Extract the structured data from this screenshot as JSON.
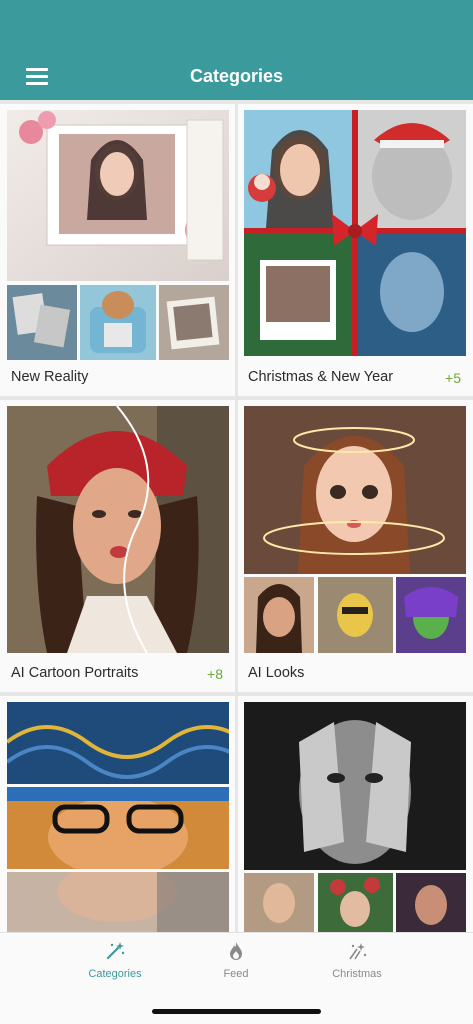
{
  "header": {
    "title": "Categories"
  },
  "categories": [
    {
      "label": "New Reality",
      "badge": ""
    },
    {
      "label": "Christmas & New Year",
      "badge": "+5"
    },
    {
      "label": "AI Cartoon Portraits",
      "badge": "+8"
    },
    {
      "label": "AI Looks",
      "badge": ""
    }
  ],
  "tabs": [
    {
      "label": "Categories",
      "icon": "magic-wand-icon",
      "active": true
    },
    {
      "label": "Feed",
      "icon": "flame-icon",
      "active": false
    },
    {
      "label": "Christmas",
      "icon": "sparkle-icon",
      "active": false
    }
  ],
  "colors": {
    "header": "#3a9a9c",
    "accent": "#3a9a9c",
    "badge": "#6aa93a"
  }
}
